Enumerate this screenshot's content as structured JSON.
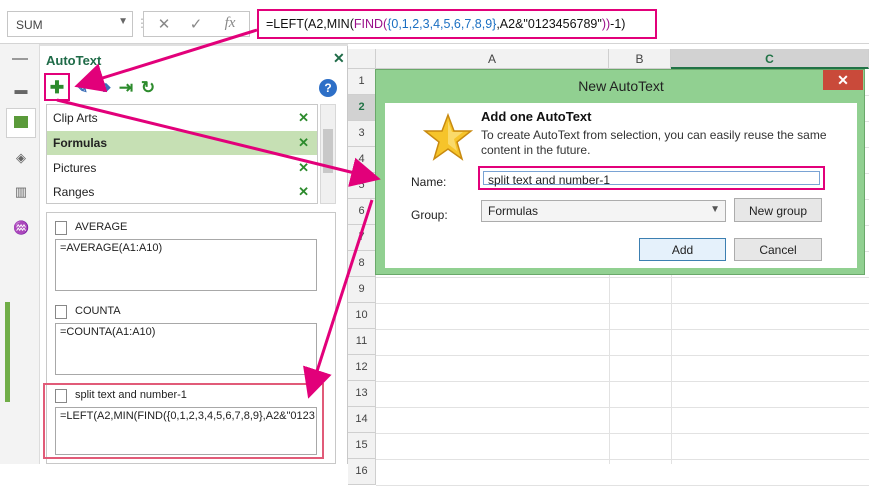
{
  "formula_bar": {
    "name_box": "SUM",
    "cancel_glyph": "✕",
    "enter_glyph": "✓",
    "fx_glyph": "fx",
    "formula_pre": "=LEFT(A2,MIN(",
    "formula_find": "FIND(",
    "formula_brace": "{0,1,2,3,4,5,6,7,8,9}",
    "formula_mid": ",A2&\"0123456789\"",
    "formula_close": "))",
    "formula_end": "-1)"
  },
  "panel": {
    "title": "AutoText",
    "close_glyph": "✕",
    "toolbar": [
      "plus-icon",
      "edit-icon",
      "move-icon",
      "insert-icon",
      "refresh-icon",
      "help-icon"
    ],
    "help_glyph": "?",
    "categories": [
      {
        "label": "Clip Arts",
        "selected": false
      },
      {
        "label": "Formulas",
        "selected": true
      },
      {
        "label": "Pictures",
        "selected": false
      },
      {
        "label": "Ranges",
        "selected": false
      }
    ],
    "entries": [
      {
        "name": "AVERAGE",
        "content": "=AVERAGE(A1:A10)"
      },
      {
        "name": "COUNTA",
        "content": "=COUNTA(A1:A10)"
      },
      {
        "name": "split text and number-1",
        "content": "=LEFT(A2,MIN(FIND({0,1,2,3,4,5,6,7,8,9},A2&\"0123"
      }
    ]
  },
  "grid": {
    "columns": [
      "A",
      "B",
      "C"
    ],
    "rows": [
      "1",
      "2",
      "3",
      "4",
      "5",
      "6",
      "7",
      "8",
      "9",
      "10",
      "11",
      "12",
      "13",
      "14",
      "15",
      "16"
    ],
    "selected_column": "C",
    "selected_row": "2"
  },
  "dialog": {
    "title": "New AutoText",
    "close_glyph": "✕",
    "heading": "Add one AutoText",
    "description": "To create AutoText from selection, you can easily reuse the same content in the future.",
    "name_label": "Name:",
    "name_value": "split text and number-1",
    "group_label": "Group:",
    "group_value": "Formulas",
    "new_group_label": "New group",
    "add_label": "Add",
    "cancel_label": "Cancel"
  },
  "colors": {
    "highlight": "#e2007a",
    "panel_accent": "#1f6b48",
    "dialog_frame": "#91d091",
    "selected_category": "#c6e0b4"
  }
}
